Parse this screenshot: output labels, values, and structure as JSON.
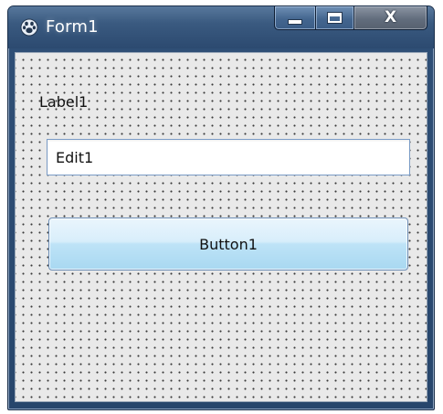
{
  "window": {
    "title": "Form1",
    "icon": "lazarus-paw-icon",
    "caption_buttons": {
      "minimize": "minimize-icon",
      "maximize": "maximize-icon",
      "close_label": "X"
    }
  },
  "form": {
    "label": "Label1",
    "edit_value": "Edit1",
    "button_label": "Button1"
  },
  "colors": {
    "titlebar": "#2f4f76",
    "client_background": "#e9e9e9",
    "grid_dots": "#3a3a3a",
    "button_gradient_top": "#eaf5fc",
    "button_gradient_bottom": "#a8d8f1",
    "edit_border": "#7a9cc7"
  }
}
